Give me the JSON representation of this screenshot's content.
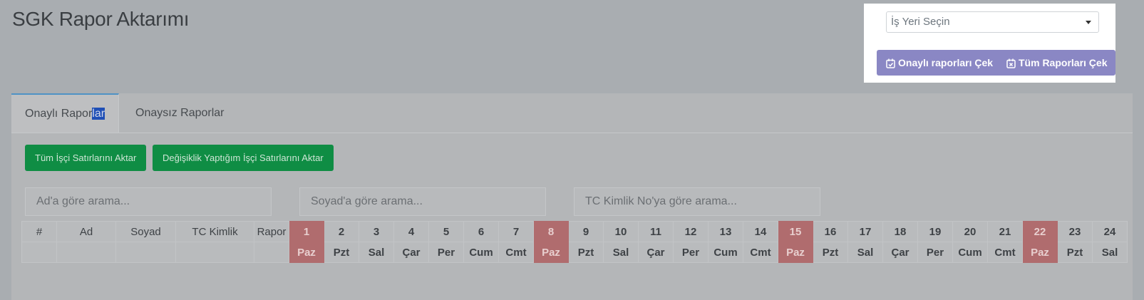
{
  "page": {
    "title": "SGK Rapor Aktarımı"
  },
  "tabs": [
    {
      "label_a": "Onaylı Rapor",
      "label_b": "lar"
    },
    {
      "label": "Onaysız Raporlar"
    }
  ],
  "actions": {
    "transfer_all": "Tüm İşçi Satırlarını Aktar",
    "transfer_changed": "Değişiklik Yaptığım İşçi Satırlarını Aktar"
  },
  "search": {
    "name_placeholder": "Ad'a göre arama...",
    "surname_placeholder": "Soyad'a göre arama...",
    "tc_placeholder": "TC Kimlik No'ya göre arama..."
  },
  "table": {
    "headers": [
      "#",
      "Ad",
      "Soyad",
      "TC Kimlik",
      "Rapor"
    ],
    "days": [
      "1",
      "2",
      "3",
      "4",
      "5",
      "6",
      "7",
      "8",
      "9",
      "10",
      "11",
      "12",
      "13",
      "14",
      "15",
      "16",
      "17",
      "18",
      "19",
      "20",
      "21",
      "22",
      "23",
      "24"
    ],
    "weekdays": [
      "Paz",
      "Pzt",
      "Sal",
      "Çar",
      "Per",
      "Cum",
      "Cmt",
      "Paz",
      "Pzt",
      "Sal",
      "Çar",
      "Per",
      "Cum",
      "Cmt",
      "Paz",
      "Pzt",
      "Sal",
      "Çar",
      "Per",
      "Cum",
      "Cmt",
      "Paz",
      "Pzt",
      "Sal"
    ],
    "weekend_color": "#b06c6e"
  },
  "panel": {
    "select_placeholder": "İş Yeri Seçin",
    "approved_button": "Onaylı raporları Çek",
    "all_button": "Tüm Raporları Çek",
    "button_color": "#8a87c4",
    "icons": [
      "calendar-check-icon",
      "calendar-x-icon"
    ]
  }
}
